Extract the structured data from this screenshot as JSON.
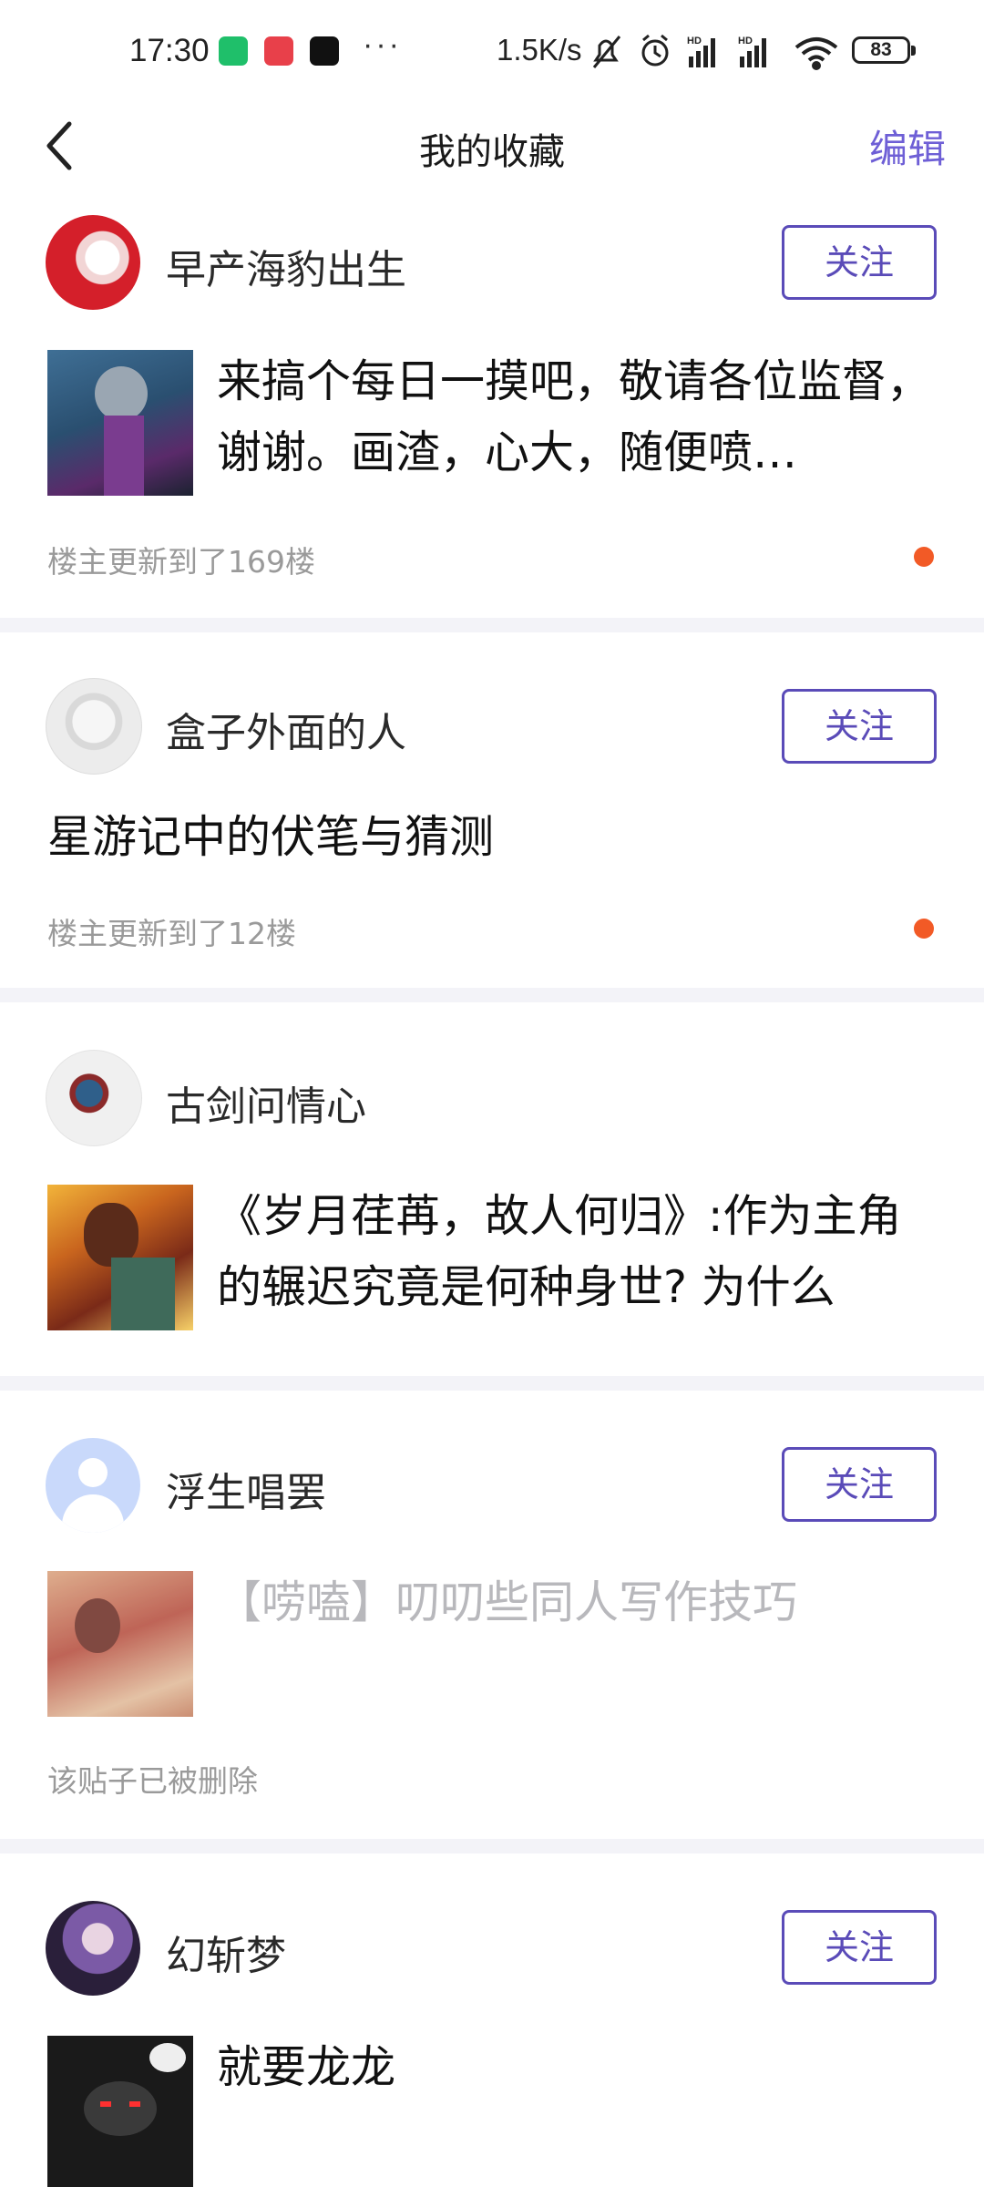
{
  "status_bar": {
    "time": "17:30",
    "net_speed": "1.5K/s",
    "battery": "83"
  },
  "header": {
    "title": "我的收藏",
    "edit_label": "编辑"
  },
  "colors": {
    "accent": "#5a4bb8",
    "edit": "#6e5fd6",
    "unread_dot": "#f25a26",
    "meta_text": "#9a9a9a"
  },
  "favorites": [
    {
      "author": "早产海豹出生",
      "follow_label": "关注",
      "title": "来搞个每日一摸吧，敬请各位监督，谢谢。画渣，心大，随便喷…",
      "meta": "楼主更新到了169楼",
      "unread": true
    },
    {
      "author": "盒子外面的人",
      "follow_label": "关注",
      "title": "星游记中的伏笔与猜测",
      "meta": "楼主更新到了12楼",
      "unread": true
    },
    {
      "author": "古剑问情心",
      "title": "《岁月荏苒，故人何归》:作为主角的辗迟究竟是何种身世? 为什么"
    },
    {
      "author": "浮生唱罢",
      "follow_label": "关注",
      "title": "【唠嗑】叨叨些同人写作技巧",
      "meta": "该贴子已被删除"
    },
    {
      "author": "幻斩梦",
      "follow_label": "关注",
      "title": "就要龙龙"
    }
  ]
}
